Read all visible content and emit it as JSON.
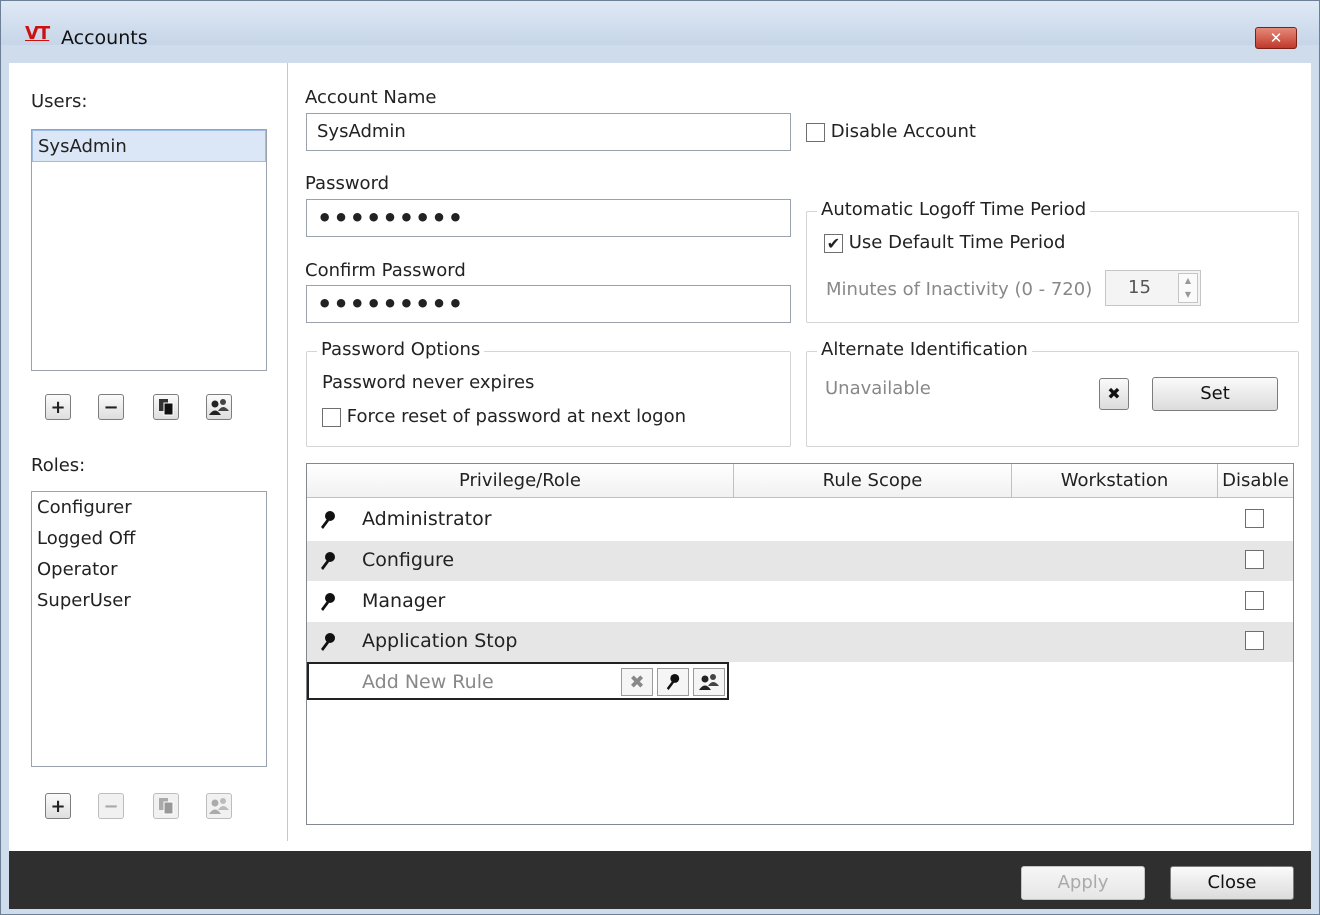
{
  "window": {
    "logo": "VT",
    "title": "Accounts",
    "close_glyph": "✕"
  },
  "users": {
    "label": "Users:",
    "items": [
      "SysAdmin"
    ],
    "selected": "SysAdmin"
  },
  "user_buttons": {
    "add": "+",
    "remove": "−"
  },
  "roles": {
    "label": "Roles:",
    "items": [
      "Configurer",
      "Logged Off",
      "Operator",
      "SuperUser"
    ]
  },
  "role_buttons": {
    "add": "+",
    "remove": "−"
  },
  "account": {
    "name_label": "Account Name",
    "name_value": "SysAdmin",
    "disable_label": "Disable Account",
    "password_label": "Password",
    "password_value": "•••••••••",
    "confirm_label": "Confirm Password",
    "confirm_value": "•••••••••"
  },
  "logoff": {
    "title": "Automatic Logoff Time Period",
    "use_default_label": "Use Default Time Period",
    "use_default_checked": true,
    "minutes_label": "Minutes of Inactivity (0 - 720)",
    "minutes_value": "15"
  },
  "password_options": {
    "title": "Password Options",
    "never_expires": "Password never expires",
    "force_reset_label": "Force reset of password at next logon",
    "force_reset_checked": false
  },
  "alt_id": {
    "title": "Alternate Identification",
    "status": "Unavailable",
    "clear_glyph": "✖",
    "set_label": "Set"
  },
  "grid": {
    "columns": [
      "Privilege/Role",
      "Rule Scope",
      "Workstation",
      "Disable"
    ],
    "rows": [
      {
        "name": "Administrator",
        "disabled": false
      },
      {
        "name": "Configure",
        "disabled": false
      },
      {
        "name": "Manager",
        "disabled": false
      },
      {
        "name": "Application Stop",
        "disabled": false
      }
    ],
    "new_rule_placeholder": "Add New Rule",
    "new_rule_clear": "✖"
  },
  "footer": {
    "apply_label": "Apply",
    "close_label": "Close"
  },
  "icons": [
    "copy-icon",
    "users-icon",
    "key-icon",
    "clear-icon"
  ]
}
